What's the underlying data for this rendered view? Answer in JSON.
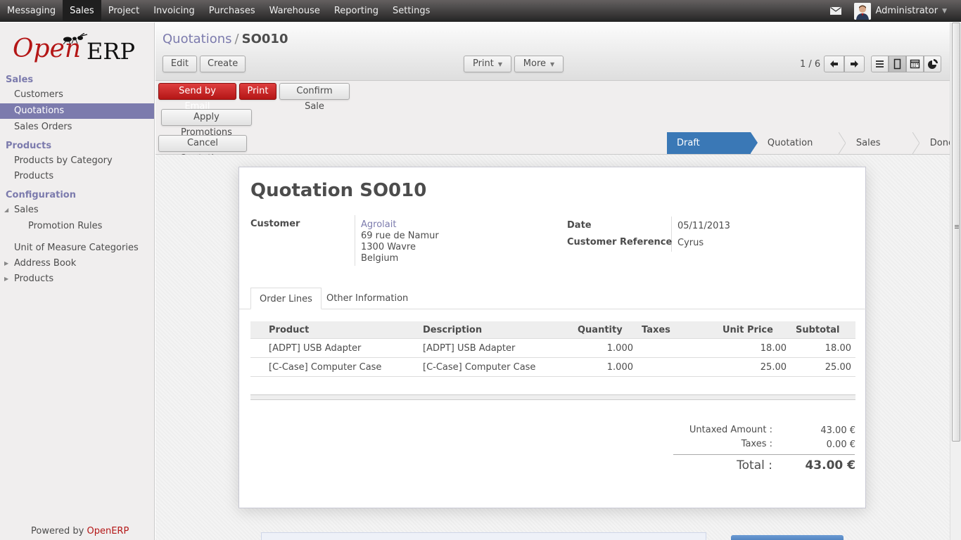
{
  "topbar": {
    "menu": [
      "Messaging",
      "Sales",
      "Project",
      "Invoicing",
      "Purchases",
      "Warehouse",
      "Reporting",
      "Settings"
    ],
    "active": "Sales",
    "user": "Administrator"
  },
  "sidebar": {
    "logo_open": "Open",
    "logo_erp": "ERP",
    "sections": [
      {
        "title": "Sales",
        "items": [
          "Customers",
          "Quotations",
          "Sales Orders"
        ]
      },
      {
        "title": "Products",
        "items": [
          "Products by Category",
          "Products"
        ]
      },
      {
        "title": "Configuration",
        "items": [
          "Sales",
          "Promotion Rules",
          "Unit of Measure Categories",
          "Address Book",
          "Products"
        ]
      }
    ],
    "active_item": "Quotations",
    "powered_prefix": "Powered by ",
    "powered_brand": "OpenERP"
  },
  "header": {
    "breadcrumb_link": "Quotations",
    "breadcrumb_sep": "/",
    "breadcrumb_current": "SO010",
    "edit_label": "Edit",
    "create_label": "Create",
    "print_label": "Print",
    "more_label": "More",
    "pager": "1 / 6"
  },
  "toolbar": {
    "send_email": "Send by Email",
    "print": "Print",
    "confirm_sale": "Confirm Sale",
    "apply_promotions": "Apply Promotions",
    "cancel_quotation": "Cancel Quotation"
  },
  "status_steps": [
    "Draft Quotation",
    "Quotation Sent",
    "Sales Order",
    "Done"
  ],
  "status_active": "Draft Quotation",
  "form": {
    "title": "Quotation SO010",
    "customer_label": "Customer",
    "customer_name": "Agrolait",
    "customer_addr1": "69 rue de Namur",
    "customer_addr2": "1300 Wavre",
    "customer_addr3": "Belgium",
    "date_label": "Date",
    "date_value": "05/11/2013",
    "ref_label": "Customer Reference",
    "ref_value": "Cyrus",
    "tabs": [
      "Order Lines",
      "Other Information"
    ],
    "columns": [
      "Product",
      "Description",
      "Quantity",
      "Taxes",
      "Unit Price",
      "Subtotal"
    ],
    "lines": [
      {
        "product": "[ADPT] USB Adapter",
        "description": "[ADPT] USB Adapter",
        "quantity": "1.000",
        "taxes": "",
        "unit_price": "18.00",
        "subtotal": "18.00"
      },
      {
        "product": "[C-Case] Computer Case",
        "description": "[C-Case] Computer Case",
        "quantity": "1.000",
        "taxes": "",
        "unit_price": "25.00",
        "subtotal": "25.00"
      }
    ],
    "untaxed_label": "Untaxed Amount :",
    "untaxed_value": "43.00 €",
    "taxes_label": "Taxes :",
    "taxes_value": "0.00 €",
    "total_label": "Total :",
    "total_value": "43.00 €"
  },
  "colors": {
    "accent": "#7c7bad",
    "red": "#b41616",
    "status_blue": "#3a78b6"
  }
}
